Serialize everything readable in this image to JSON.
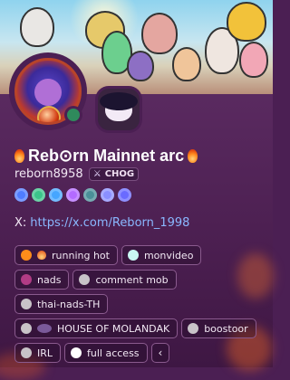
{
  "profile": {
    "title": "Reb⊙rn Mainnet arc",
    "username": "reborn8958",
    "tag_label": "CHOG",
    "x_label": "X:",
    "x_link": "https://x.com/Reborn_1998",
    "status": "online"
  },
  "badges": [
    {
      "name": "nitro-badge",
      "color": "#4f7cff"
    },
    {
      "name": "verified-badge",
      "color": "#3bc48a"
    },
    {
      "name": "diamond-badge",
      "color": "#46a6ff"
    },
    {
      "name": "hex-badge",
      "color": "#b36bff"
    },
    {
      "name": "hashtag-badge",
      "color": "#4a8f98"
    },
    {
      "name": "gear-badge",
      "color": "#8a8fff"
    },
    {
      "name": "boost-badge",
      "color": "#6a6bff"
    }
  ],
  "roles": [
    [
      {
        "label": "running hot",
        "color": "#ff8c1a",
        "emoji": true
      },
      {
        "label": "monvideo",
        "color": "#c9f7f3"
      }
    ],
    [
      {
        "label": "nads",
        "color": "#b13c85"
      },
      {
        "label": "comment mob",
        "color": "#c8c3c8"
      }
    ],
    [
      {
        "label": "thai-nads-TH",
        "color": "#c8c3c8"
      }
    ],
    [
      {
        "label": "HOUSE OF MOLANDAK",
        "color": "#c8c3c8",
        "emoji": true
      },
      {
        "label": "boostoor",
        "color": "#c8c3c8"
      }
    ],
    [
      {
        "label": "IRL",
        "color": "#c8c3c8"
      },
      {
        "label": "full access",
        "color": "#ffffff"
      }
    ]
  ],
  "more_label": "‹"
}
